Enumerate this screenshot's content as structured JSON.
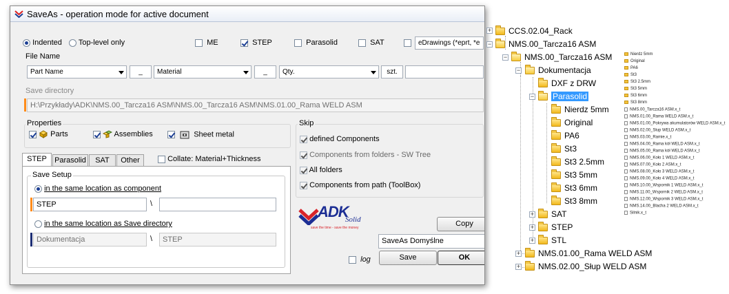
{
  "dialog": {
    "title": "SaveAs - operation mode for active document",
    "mode": {
      "indented": "Indented",
      "top_level": "Top-level only"
    },
    "formats": {
      "me": "ME",
      "step": "STEP",
      "parasolid": "Parasolid",
      "sat": "SAT",
      "edrawings": "eDrawings (*eprt, *e"
    },
    "file_name": {
      "label": "File Name",
      "part1": "Part Name",
      "sep1": "_",
      "part2": "Material",
      "sep2": "_",
      "part3": "Qty.",
      "suffix": "szt."
    },
    "save_directory": {
      "label": "Save directory",
      "path": "H:\\Przykłady\\ADK\\NMS.00_Tarcza16 ASM\\NMS.00_Tarcza16 ASM\\NMS.01.00_Rama WELD ASM"
    },
    "properties": {
      "label": "Properties",
      "parts": "Parts",
      "assemblies": "Assemblies",
      "sheet_metal": "Sheet metal"
    },
    "skip": {
      "label": "Skip",
      "defined": "defined Components",
      "from_folders": "Components from folders - SW Tree",
      "all_folders": "All folders",
      "from_path": "Components from path (ToolBox)"
    },
    "tabs": [
      "STEP",
      "Parasolid",
      "SAT",
      "Other"
    ],
    "collate": "Collate: Material+Thickness",
    "save_setup": {
      "label": "Save Setup",
      "opt1": "in the same location as component",
      "opt1_value": "STEP",
      "opt1_sep": "\\",
      "opt2": "in the same location as Save directory",
      "opt2_value": "Dokumentacja",
      "opt2_sep": "\\",
      "opt2_value2": "STEP"
    },
    "logo": {
      "main": "ADK",
      "sub": "Solid",
      "tagline": "save the time - save the money"
    },
    "copy_button": "Copy",
    "preset": "SaveAs Domyślne",
    "log_label": "log",
    "save_button": "Save",
    "ok_button": "OK"
  },
  "tree": {
    "items": [
      {
        "label": "CCS.02.04_Rack"
      },
      {
        "label": "NMS.00_Tarcza16 ASM"
      },
      {
        "label": "NMS.00_Tarcza16 ASM"
      },
      {
        "label": "Dokumentacja"
      },
      {
        "label": "DXF z DRW"
      },
      {
        "label": "Parasolid"
      },
      {
        "label": "Nierdz 5mm"
      },
      {
        "label": "Original"
      },
      {
        "label": "PA6"
      },
      {
        "label": "St3"
      },
      {
        "label": "St3 2.5mm"
      },
      {
        "label": "St3 5mm"
      },
      {
        "label": "St3 6mm"
      },
      {
        "label": "St3 8mm"
      },
      {
        "label": "SAT"
      },
      {
        "label": "STEP"
      },
      {
        "label": "STL"
      },
      {
        "label": "NMS.01.00_Rama WELD ASM"
      },
      {
        "label": "NMS.02.00_Słup WELD ASM"
      }
    ],
    "selected": "Parasolid",
    "accent": "#3399ff"
  },
  "files": {
    "folders": [
      "Nierdz 5mm",
      "Original",
      "PA6",
      "St3",
      "St3 2.5mm",
      "St3 5mm",
      "St3 6mm",
      "St3 8mm"
    ],
    "files": [
      "NMS.00_Tarcza16 ASM.x_t",
      "NMS.01.00_Rama WELD ASM.x_t",
      "NMS.01.00_Pokrywa akumulatorów WELD ASM.x_t",
      "NMS.02.00_Słup WELD ASM.x_t",
      "NMS.03.00_Ramie.x_t",
      "NMS.04.00_Rama kół WELD ASM.x_t",
      "NMS.05.00_Rama kół WELD ASM.x_t",
      "NMS.06.00_Koło 1 WELD ASM.x_t",
      "NMS.07.00_Koło 2 ASM.x_t",
      "NMS.08.00_Koło 3 WELD ASM.x_t",
      "NMS.09.00_Koło 4 WELD ASM.x_t",
      "NMS.10.00_Wspornik 1 WELD ASM.x_t",
      "NMS.11.00_Wspornik 2 WELD ASM.x_t",
      "NMS.12.00_Wspornik 3 WELD ASM.x_t",
      "NMS.14.00_Blacha 2 WELD ASM.x_t",
      "Silnik.x_t"
    ]
  }
}
